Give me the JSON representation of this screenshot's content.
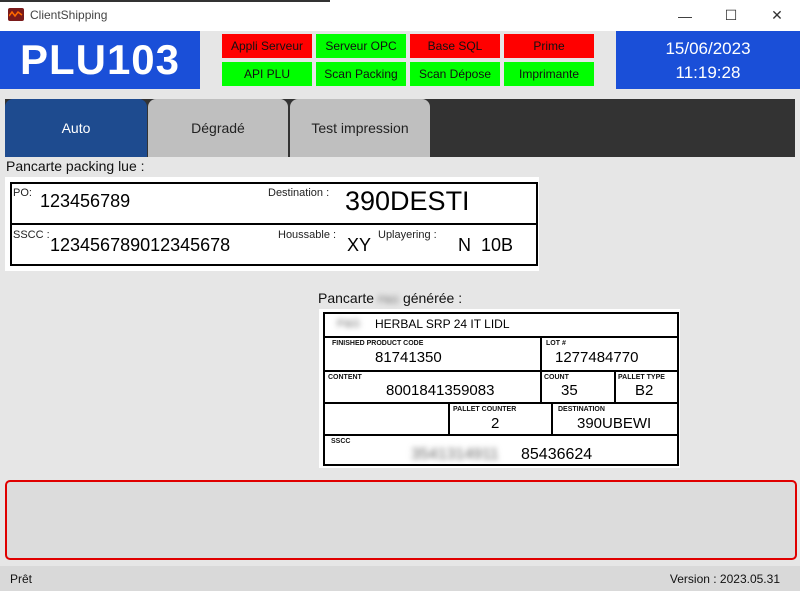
{
  "window": {
    "title": "ClientShipping",
    "minimize": "—",
    "maximize": "☐",
    "close": "✕"
  },
  "header": {
    "station": "PLU103",
    "status": [
      {
        "label": "Appli Serveur",
        "color": "#ff0000"
      },
      {
        "label": "Serveur OPC",
        "color": "#00ff00"
      },
      {
        "label": "Base SQL",
        "color": "#ff0000"
      },
      {
        "label": "Prime",
        "color": "#ff0000"
      },
      {
        "label": "API PLU",
        "color": "#00ff00"
      },
      {
        "label": "Scan Packing",
        "color": "#00ff00"
      },
      {
        "label": "Scan Dépose",
        "color": "#00ff00"
      },
      {
        "label": "Imprimante",
        "color": "#00ff00"
      }
    ],
    "date": "15/06/2023",
    "time": "11:19:28"
  },
  "tabs": [
    {
      "label": "Auto",
      "active": true
    },
    {
      "label": "Dégradé",
      "active": false
    },
    {
      "label": "Test impression",
      "active": false
    }
  ],
  "packing": {
    "title": "Pancarte packing lue :",
    "po_label": "PO:",
    "po_value": "123456789",
    "destination_label": "Destination :",
    "destination_value": "390DESTI",
    "sscc_label": "SSCC :",
    "sscc_value": "123456789012345678",
    "houssable_label": "Houssable :",
    "houssable_value": "XY",
    "uplayering_label": "Uplayering :",
    "uplayering_value": "N  10B"
  },
  "generated": {
    "title_prefix": "Pancarte",
    "title_blurred": "P&G",
    "title_suffix": "générée :",
    "brand_blurred": "P&G",
    "product": "HERBAL SRP 24 IT LIDL",
    "fpc_label": "FINISHED PRODUCT CODE",
    "fpc_value": "81741350",
    "lot_label": "LOT #",
    "lot_value": "1277484770",
    "content_label": "CONTENT",
    "content_value": "8001841359083",
    "count_label": "COUNT",
    "count_value": "35",
    "pallet_type_label": "PALLET TYPE",
    "pallet_type_value": "B2",
    "pallet_counter_label": "PALLET COUNTER",
    "pallet_counter_value": "2",
    "destination_label": "DESTINATION",
    "destination_value": "390UBEWI",
    "sscc_label": "SSCC",
    "sscc_blurred": "3541314911",
    "sscc_value": "85436624"
  },
  "statusbar": {
    "left": "Prêt",
    "right": "Version : 2023.05.31"
  }
}
